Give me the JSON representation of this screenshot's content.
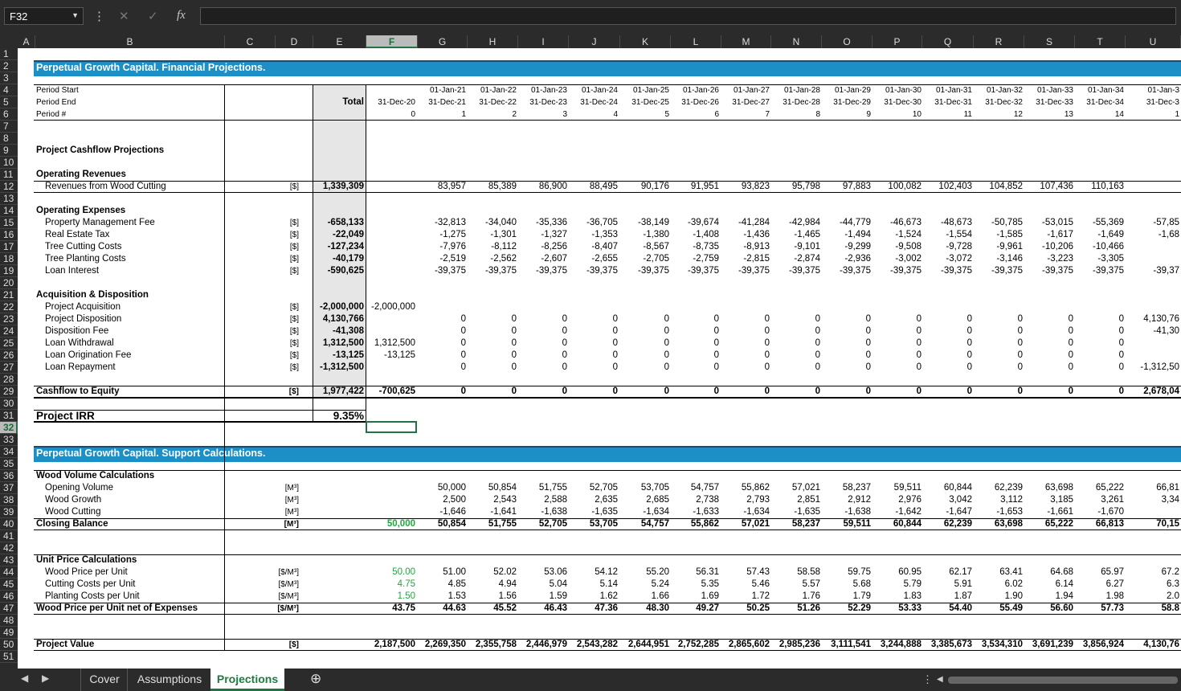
{
  "formula_bar": {
    "name_box": "F32",
    "fx": "fx",
    "formula": ""
  },
  "columns": [
    "A",
    "B",
    "C",
    "D",
    "E",
    "F",
    "G",
    "H",
    "I",
    "J",
    "K",
    "L",
    "M",
    "N",
    "O",
    "P",
    "Q",
    "R",
    "S",
    "T",
    "U"
  ],
  "selected_column": "F",
  "selected_row": "32",
  "headers": {
    "title1": "Perpetual Growth Capital. Financial Projections.",
    "title2": "Perpetual Growth Capital. Support Calculations.",
    "period_start": "Period Start",
    "period_end": "Period End",
    "period_num": "Period #",
    "total": "Total",
    "starts": [
      "",
      "01-Jan-21",
      "01-Jan-22",
      "01-Jan-23",
      "01-Jan-24",
      "01-Jan-25",
      "01-Jan-26",
      "01-Jan-27",
      "01-Jan-28",
      "01-Jan-29",
      "01-Jan-30",
      "01-Jan-31",
      "01-Jan-32",
      "01-Jan-33",
      "01-Jan-34",
      "01-Jan-3"
    ],
    "ends": [
      "31-Dec-20",
      "31-Dec-21",
      "31-Dec-22",
      "31-Dec-23",
      "31-Dec-24",
      "31-Dec-25",
      "31-Dec-26",
      "31-Dec-27",
      "31-Dec-28",
      "31-Dec-29",
      "31-Dec-30",
      "31-Dec-31",
      "31-Dec-32",
      "31-Dec-33",
      "31-Dec-34",
      "31-Dec-3"
    ],
    "periods": [
      "0",
      "1",
      "2",
      "3",
      "4",
      "5",
      "6",
      "7",
      "8",
      "9",
      "10",
      "11",
      "12",
      "13",
      "14",
      "1"
    ]
  },
  "section_labels": {
    "cashflow": "Project Cashflow Projections",
    "op_rev": "Operating Revenues",
    "op_exp": "Operating Expenses",
    "acq": "Acquisition & Disposition",
    "wood": "Wood Volume Calculations",
    "unit": "Unit Price Calculations"
  },
  "rows": [
    {
      "row": 12,
      "label": "Revenues from Wood Cutting",
      "unit": "[$]",
      "total": "1,339,309",
      "indent": true,
      "total_bold": true,
      "vals": [
        "",
        "83,957",
        "85,389",
        "86,900",
        "88,495",
        "90,176",
        "91,951",
        "93,823",
        "95,798",
        "97,883",
        "100,082",
        "102,403",
        "104,852",
        "107,436",
        "110,163",
        ""
      ]
    },
    {
      "row": 15,
      "label": "Property Management Fee",
      "unit": "[$]",
      "total": "-658,133",
      "indent": true,
      "total_bold": true,
      "vals": [
        "",
        "-32,813",
        "-34,040",
        "-35,336",
        "-36,705",
        "-38,149",
        "-39,674",
        "-41,284",
        "-42,984",
        "-44,779",
        "-46,673",
        "-48,673",
        "-50,785",
        "-53,015",
        "-55,369",
        "-57,85"
      ]
    },
    {
      "row": 16,
      "label": "Real Estate Tax",
      "unit": "[$]",
      "total": "-22,049",
      "indent": true,
      "total_bold": true,
      "vals": [
        "",
        "-1,275",
        "-1,301",
        "-1,327",
        "-1,353",
        "-1,380",
        "-1,408",
        "-1,436",
        "-1,465",
        "-1,494",
        "-1,524",
        "-1,554",
        "-1,585",
        "-1,617",
        "-1,649",
        "-1,68"
      ]
    },
    {
      "row": 17,
      "label": "Tree Cutting Costs",
      "unit": "[$]",
      "total": "-127,234",
      "indent": true,
      "total_bold": true,
      "vals": [
        "",
        "-7,976",
        "-8,112",
        "-8,256",
        "-8,407",
        "-8,567",
        "-8,735",
        "-8,913",
        "-9,101",
        "-9,299",
        "-9,508",
        "-9,728",
        "-9,961",
        "-10,206",
        "-10,466",
        ""
      ]
    },
    {
      "row": 18,
      "label": "Tree Planting Costs",
      "unit": "[$]",
      "total": "-40,179",
      "indent": true,
      "total_bold": true,
      "vals": [
        "",
        "-2,519",
        "-2,562",
        "-2,607",
        "-2,655",
        "-2,705",
        "-2,759",
        "-2,815",
        "-2,874",
        "-2,936",
        "-3,002",
        "-3,072",
        "-3,146",
        "-3,223",
        "-3,305",
        ""
      ]
    },
    {
      "row": 19,
      "label": "Loan Interest",
      "unit": "[$]",
      "total": "-590,625",
      "indent": true,
      "total_bold": true,
      "vals": [
        "",
        "-39,375",
        "-39,375",
        "-39,375",
        "-39,375",
        "-39,375",
        "-39,375",
        "-39,375",
        "-39,375",
        "-39,375",
        "-39,375",
        "-39,375",
        "-39,375",
        "-39,375",
        "-39,375",
        "-39,37"
      ]
    },
    {
      "row": 22,
      "label": "Project Acquisition",
      "unit": "[$]",
      "total": "-2,000,000",
      "indent": true,
      "total_bold": true,
      "vals": [
        "-2,000,000",
        "",
        "",
        "",
        "",
        "",
        "",
        "",
        "",
        "",
        "",
        "",
        "",
        "",
        "",
        ""
      ]
    },
    {
      "row": 23,
      "label": "Project Disposition",
      "unit": "[$]",
      "total": "4,130,766",
      "indent": true,
      "total_bold": true,
      "vals": [
        "",
        "0",
        "0",
        "0",
        "0",
        "0",
        "0",
        "0",
        "0",
        "0",
        "0",
        "0",
        "0",
        "0",
        "0",
        "4,130,76"
      ]
    },
    {
      "row": 24,
      "label": "Disposition Fee",
      "unit": "[$]",
      "total": "-41,308",
      "indent": true,
      "total_bold": true,
      "vals": [
        "",
        "0",
        "0",
        "0",
        "0",
        "0",
        "0",
        "0",
        "0",
        "0",
        "0",
        "0",
        "0",
        "0",
        "0",
        "-41,30"
      ]
    },
    {
      "row": 25,
      "label": "Loan Withdrawal",
      "unit": "[$]",
      "total": "1,312,500",
      "indent": true,
      "total_bold": true,
      "vals": [
        "1,312,500",
        "0",
        "0",
        "0",
        "0",
        "0",
        "0",
        "0",
        "0",
        "0",
        "0",
        "0",
        "0",
        "0",
        "0",
        ""
      ]
    },
    {
      "row": 26,
      "label": "Loan Origination Fee",
      "unit": "[$]",
      "total": "-13,125",
      "indent": true,
      "total_bold": true,
      "vals": [
        "-13,125",
        "0",
        "0",
        "0",
        "0",
        "0",
        "0",
        "0",
        "0",
        "0",
        "0",
        "0",
        "0",
        "0",
        "0",
        ""
      ]
    },
    {
      "row": 27,
      "label": "Loan Repayment",
      "unit": "[$]",
      "total": "-1,312,500",
      "indent": true,
      "total_bold": true,
      "vals": [
        "",
        "0",
        "0",
        "0",
        "0",
        "0",
        "0",
        "0",
        "0",
        "0",
        "0",
        "0",
        "0",
        "0",
        "0",
        "-1,312,50"
      ]
    },
    {
      "row": 29,
      "label": "Cashflow to Equity",
      "unit": "[$]",
      "total": "1,977,422",
      "indent": false,
      "bold": true,
      "total_bold": true,
      "vals": [
        "-700,625",
        "0",
        "0",
        "0",
        "0",
        "0",
        "0",
        "0",
        "0",
        "0",
        "0",
        "0",
        "0",
        "0",
        "0",
        "2,678,04"
      ]
    },
    {
      "row": 37,
      "label": "Opening Volume",
      "unit": "[M³]",
      "total": "",
      "indent": true,
      "vals": [
        "",
        "50,000",
        "50,854",
        "51,755",
        "52,705",
        "53,705",
        "54,757",
        "55,862",
        "57,021",
        "58,237",
        "59,511",
        "60,844",
        "62,239",
        "63,698",
        "65,222",
        "66,81"
      ]
    },
    {
      "row": 38,
      "label": "Wood Growth",
      "unit": "[M³]",
      "total": "",
      "indent": true,
      "vals": [
        "",
        "2,500",
        "2,543",
        "2,588",
        "2,635",
        "2,685",
        "2,738",
        "2,793",
        "2,851",
        "2,912",
        "2,976",
        "3,042",
        "3,112",
        "3,185",
        "3,261",
        "3,34"
      ]
    },
    {
      "row": 39,
      "label": "Wood Cutting",
      "unit": "[M³]",
      "total": "",
      "indent": true,
      "vals": [
        "",
        "-1,646",
        "-1,641",
        "-1,638",
        "-1,635",
        "-1,634",
        "-1,633",
        "-1,634",
        "-1,635",
        "-1,638",
        "-1,642",
        "-1,647",
        "-1,653",
        "-1,661",
        "-1,670",
        ""
      ]
    },
    {
      "row": 40,
      "label": "Closing Balance",
      "unit": "[M³]",
      "total": "",
      "indent": false,
      "bold": true,
      "greenF": true,
      "vals": [
        "50,000",
        "50,854",
        "51,755",
        "52,705",
        "53,705",
        "54,757",
        "55,862",
        "57,021",
        "58,237",
        "59,511",
        "60,844",
        "62,239",
        "63,698",
        "65,222",
        "66,813",
        "70,15"
      ]
    },
    {
      "row": 44,
      "label": "Wood Price per Unit",
      "unit": "[$/M³]",
      "total": "",
      "indent": true,
      "greenF": true,
      "vals": [
        "50.00",
        "51.00",
        "52.02",
        "53.06",
        "54.12",
        "55.20",
        "56.31",
        "57.43",
        "58.58",
        "59.75",
        "60.95",
        "62.17",
        "63.41",
        "64.68",
        "65.97",
        "67.2"
      ]
    },
    {
      "row": 45,
      "label": "Cutting Costs per Unit",
      "unit": "[$/M³]",
      "total": "",
      "indent": true,
      "greenF": true,
      "vals": [
        "4.75",
        "4.85",
        "4.94",
        "5.04",
        "5.14",
        "5.24",
        "5.35",
        "5.46",
        "5.57",
        "5.68",
        "5.79",
        "5.91",
        "6.02",
        "6.14",
        "6.27",
        "6.3"
      ]
    },
    {
      "row": 46,
      "label": "Planting Costs per Unit",
      "unit": "[$/M³]",
      "total": "",
      "indent": true,
      "greenF": true,
      "vals": [
        "1.50",
        "1.53",
        "1.56",
        "1.59",
        "1.62",
        "1.66",
        "1.69",
        "1.72",
        "1.76",
        "1.79",
        "1.83",
        "1.87",
        "1.90",
        "1.94",
        "1.98",
        "2.0"
      ]
    },
    {
      "row": 47,
      "label": "Wood Price per Unit net of Expenses",
      "unit": "[$/M³]",
      "total": "",
      "indent": false,
      "bold": true,
      "vals": [
        "43.75",
        "44.63",
        "45.52",
        "46.43",
        "47.36",
        "48.30",
        "49.27",
        "50.25",
        "51.26",
        "52.29",
        "53.33",
        "54.40",
        "55.49",
        "56.60",
        "57.73",
        "58.8"
      ]
    },
    {
      "row": 50,
      "label": "Project Value",
      "unit": "[$]",
      "total": "",
      "indent": false,
      "bold": true,
      "vals": [
        "2,187,500",
        "2,269,350",
        "2,355,758",
        "2,446,979",
        "2,543,282",
        "2,644,951",
        "2,752,285",
        "2,865,602",
        "2,985,236",
        "3,111,541",
        "3,244,888",
        "3,385,673",
        "3,534,310",
        "3,691,239",
        "3,856,924",
        "4,130,76"
      ]
    }
  ],
  "irr": {
    "label": "Project IRR",
    "value": "9.35%"
  },
  "sheet_tabs": [
    "Cover",
    "Assumptions",
    "Projections"
  ],
  "active_tab": "Projections",
  "colors": {
    "band": "#1b8fc6",
    "green": "#1aaa3a",
    "excel_green": "#217346"
  }
}
